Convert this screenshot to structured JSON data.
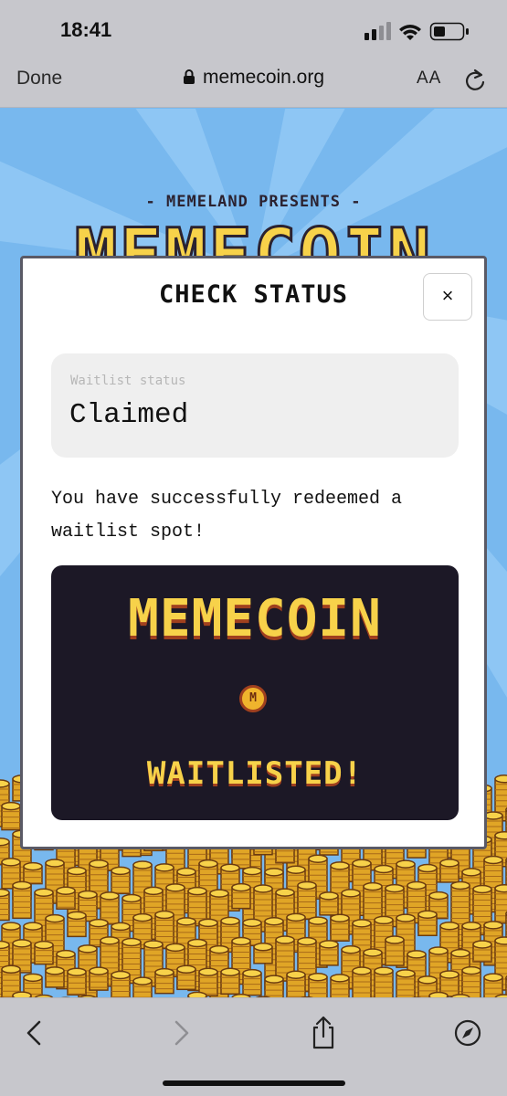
{
  "status_bar": {
    "time": "18:41"
  },
  "browser": {
    "done_label": "Done",
    "url": "memecoin.org",
    "text_size_label": "AA"
  },
  "hero": {
    "presents": "- MEMELAND PRESENTS -",
    "title": "MEMECOIN"
  },
  "modal": {
    "title": "CHECK STATUS",
    "close_label": "×",
    "status_label": "Waitlist status",
    "status_value": "Claimed",
    "message": "You have successfully redeemed a waitlist spot!",
    "card": {
      "title": "MEMECOIN",
      "coin_glyph": "M",
      "subtitle": "WAITLISTED!"
    }
  },
  "colors": {
    "sky": "#78b8ee",
    "gold": "#f7d24a",
    "card_bg": "#1c1826",
    "browser_chrome": "#c7c7cc"
  },
  "icons": [
    "lock-icon",
    "signal-icon",
    "wifi-icon",
    "battery-icon",
    "reload-icon",
    "back-icon",
    "forward-icon",
    "share-icon",
    "compass-icon"
  ]
}
